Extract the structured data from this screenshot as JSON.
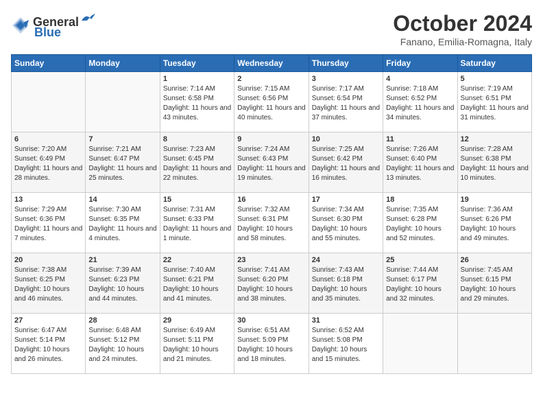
{
  "header": {
    "logo": {
      "general": "General",
      "blue": "Blue"
    },
    "title": "October 2024",
    "location": "Fanano, Emilia-Romagna, Italy"
  },
  "weekdays": [
    "Sunday",
    "Monday",
    "Tuesday",
    "Wednesday",
    "Thursday",
    "Friday",
    "Saturday"
  ],
  "weeks": [
    [
      {
        "day": "",
        "info": ""
      },
      {
        "day": "",
        "info": ""
      },
      {
        "day": "1",
        "info": "Sunrise: 7:14 AM\nSunset: 6:58 PM\nDaylight: 11 hours and 43 minutes."
      },
      {
        "day": "2",
        "info": "Sunrise: 7:15 AM\nSunset: 6:56 PM\nDaylight: 11 hours and 40 minutes."
      },
      {
        "day": "3",
        "info": "Sunrise: 7:17 AM\nSunset: 6:54 PM\nDaylight: 11 hours and 37 minutes."
      },
      {
        "day": "4",
        "info": "Sunrise: 7:18 AM\nSunset: 6:52 PM\nDaylight: 11 hours and 34 minutes."
      },
      {
        "day": "5",
        "info": "Sunrise: 7:19 AM\nSunset: 6:51 PM\nDaylight: 11 hours and 31 minutes."
      }
    ],
    [
      {
        "day": "6",
        "info": "Sunrise: 7:20 AM\nSunset: 6:49 PM\nDaylight: 11 hours and 28 minutes."
      },
      {
        "day": "7",
        "info": "Sunrise: 7:21 AM\nSunset: 6:47 PM\nDaylight: 11 hours and 25 minutes."
      },
      {
        "day": "8",
        "info": "Sunrise: 7:23 AM\nSunset: 6:45 PM\nDaylight: 11 hours and 22 minutes."
      },
      {
        "day": "9",
        "info": "Sunrise: 7:24 AM\nSunset: 6:43 PM\nDaylight: 11 hours and 19 minutes."
      },
      {
        "day": "10",
        "info": "Sunrise: 7:25 AM\nSunset: 6:42 PM\nDaylight: 11 hours and 16 minutes."
      },
      {
        "day": "11",
        "info": "Sunrise: 7:26 AM\nSunset: 6:40 PM\nDaylight: 11 hours and 13 minutes."
      },
      {
        "day": "12",
        "info": "Sunrise: 7:28 AM\nSunset: 6:38 PM\nDaylight: 11 hours and 10 minutes."
      }
    ],
    [
      {
        "day": "13",
        "info": "Sunrise: 7:29 AM\nSunset: 6:36 PM\nDaylight: 11 hours and 7 minutes."
      },
      {
        "day": "14",
        "info": "Sunrise: 7:30 AM\nSunset: 6:35 PM\nDaylight: 11 hours and 4 minutes."
      },
      {
        "day": "15",
        "info": "Sunrise: 7:31 AM\nSunset: 6:33 PM\nDaylight: 11 hours and 1 minute."
      },
      {
        "day": "16",
        "info": "Sunrise: 7:32 AM\nSunset: 6:31 PM\nDaylight: 10 hours and 58 minutes."
      },
      {
        "day": "17",
        "info": "Sunrise: 7:34 AM\nSunset: 6:30 PM\nDaylight: 10 hours and 55 minutes."
      },
      {
        "day": "18",
        "info": "Sunrise: 7:35 AM\nSunset: 6:28 PM\nDaylight: 10 hours and 52 minutes."
      },
      {
        "day": "19",
        "info": "Sunrise: 7:36 AM\nSunset: 6:26 PM\nDaylight: 10 hours and 49 minutes."
      }
    ],
    [
      {
        "day": "20",
        "info": "Sunrise: 7:38 AM\nSunset: 6:25 PM\nDaylight: 10 hours and 46 minutes."
      },
      {
        "day": "21",
        "info": "Sunrise: 7:39 AM\nSunset: 6:23 PM\nDaylight: 10 hours and 44 minutes."
      },
      {
        "day": "22",
        "info": "Sunrise: 7:40 AM\nSunset: 6:21 PM\nDaylight: 10 hours and 41 minutes."
      },
      {
        "day": "23",
        "info": "Sunrise: 7:41 AM\nSunset: 6:20 PM\nDaylight: 10 hours and 38 minutes."
      },
      {
        "day": "24",
        "info": "Sunrise: 7:43 AM\nSunset: 6:18 PM\nDaylight: 10 hours and 35 minutes."
      },
      {
        "day": "25",
        "info": "Sunrise: 7:44 AM\nSunset: 6:17 PM\nDaylight: 10 hours and 32 minutes."
      },
      {
        "day": "26",
        "info": "Sunrise: 7:45 AM\nSunset: 6:15 PM\nDaylight: 10 hours and 29 minutes."
      }
    ],
    [
      {
        "day": "27",
        "info": "Sunrise: 6:47 AM\nSunset: 5:14 PM\nDaylight: 10 hours and 26 minutes."
      },
      {
        "day": "28",
        "info": "Sunrise: 6:48 AM\nSunset: 5:12 PM\nDaylight: 10 hours and 24 minutes."
      },
      {
        "day": "29",
        "info": "Sunrise: 6:49 AM\nSunset: 5:11 PM\nDaylight: 10 hours and 21 minutes."
      },
      {
        "day": "30",
        "info": "Sunrise: 6:51 AM\nSunset: 5:09 PM\nDaylight: 10 hours and 18 minutes."
      },
      {
        "day": "31",
        "info": "Sunrise: 6:52 AM\nSunset: 5:08 PM\nDaylight: 10 hours and 15 minutes."
      },
      {
        "day": "",
        "info": ""
      },
      {
        "day": "",
        "info": ""
      }
    ]
  ]
}
